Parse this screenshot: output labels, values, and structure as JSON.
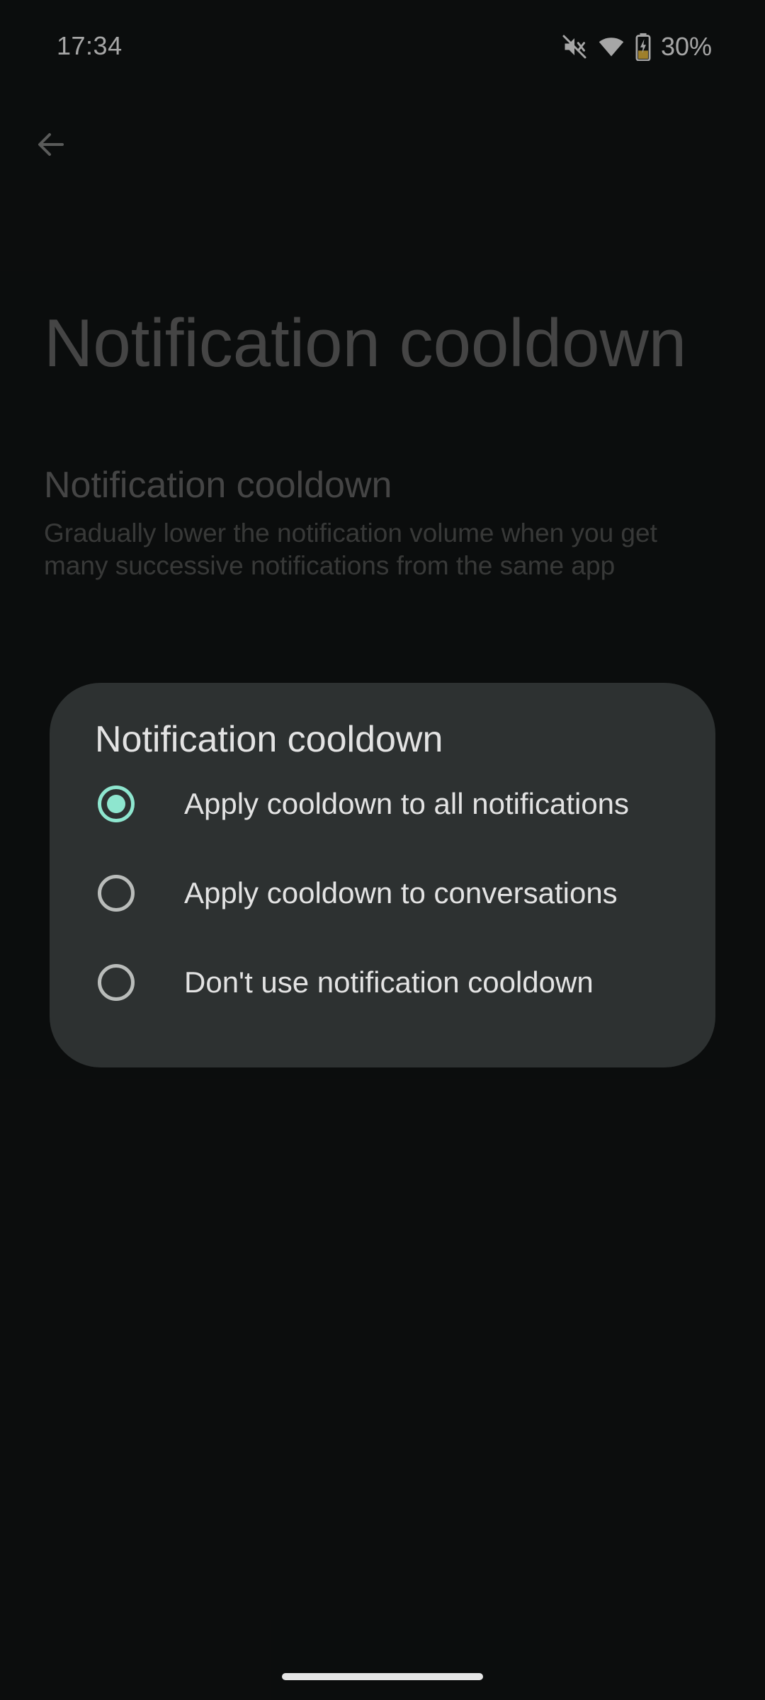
{
  "status_bar": {
    "time": "17:34",
    "battery_percent": "30%",
    "icons": [
      "mute-icon",
      "wifi-icon",
      "battery-charging-icon"
    ]
  },
  "app_bar": {
    "back_icon": "arrow-back-icon",
    "title": "Notification cooldown"
  },
  "preference": {
    "title": "Notification cooldown",
    "summary": "Gradually lower the notification volume when you get many successive notifications from the same app"
  },
  "dialog": {
    "title": "Notification cooldown",
    "options": [
      {
        "label": "Apply cooldown to all notifications",
        "checked": true
      },
      {
        "label": "Apply cooldown to conversations",
        "checked": false
      },
      {
        "label": "Don't use notification cooldown",
        "checked": false
      }
    ]
  },
  "colors": {
    "accent": "#8ee6cf",
    "dialog_surface": "#2d3131",
    "background": "#121414"
  }
}
